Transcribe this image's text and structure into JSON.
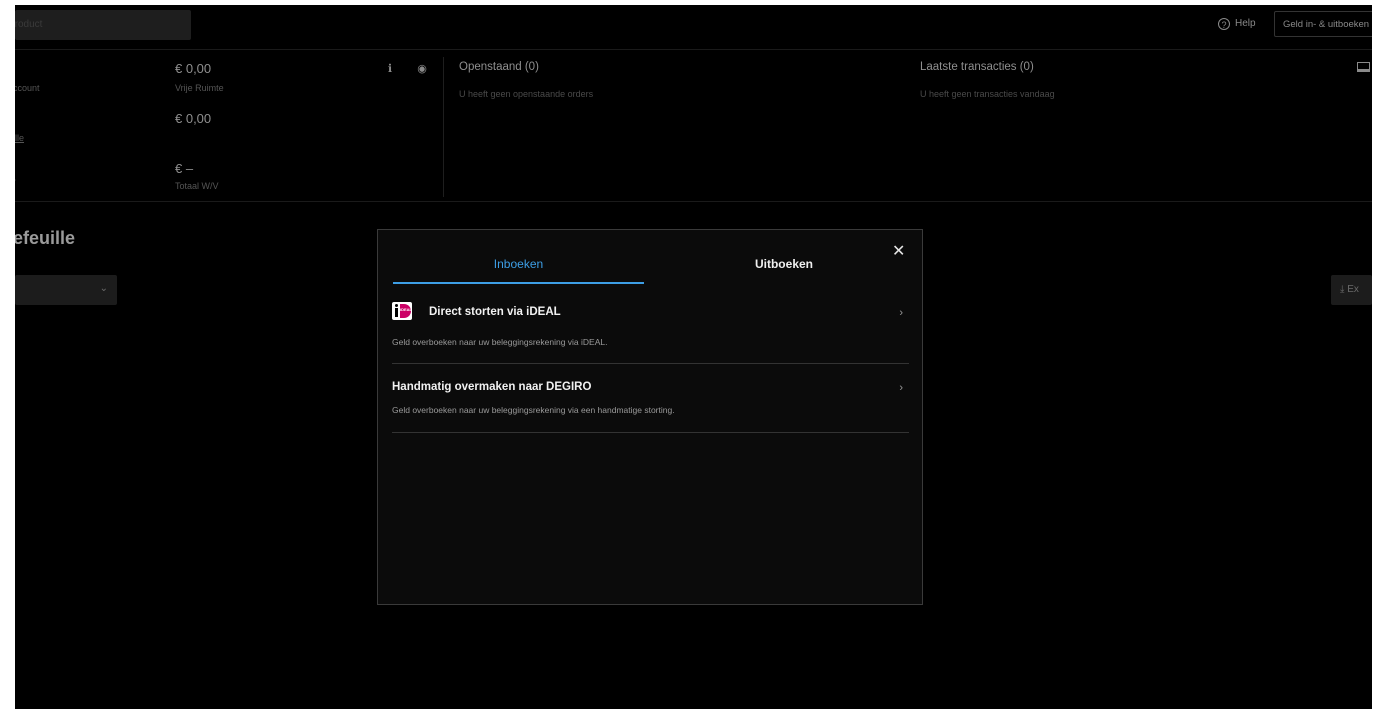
{
  "header": {
    "search_placeholder": "Product",
    "help_label": "Help",
    "deposit_button": "Geld in- & uitboeken"
  },
  "account": {
    "labels": [
      "ccount",
      "ille",
      "/"
    ],
    "free_space_amount": "€ 0,00",
    "free_space_label": "Vrije Ruimte",
    "second_amount": "€ 0,00",
    "total_amount": "€ –",
    "total_label": "Totaal W/V"
  },
  "open_orders": {
    "title": "Openstaand (0)",
    "empty_text": "U heeft geen openstaande orders"
  },
  "transactions": {
    "title": "Laatste transacties (0)",
    "empty_text": "U heeft geen transacties vandaag"
  },
  "portfolio": {
    "title": "efeuille",
    "export_label": "Ex"
  },
  "modal": {
    "tabs": [
      {
        "label": "Inboeken",
        "active": true
      },
      {
        "label": "Uitboeken",
        "active": false
      }
    ],
    "close_symbol": "✕",
    "options": [
      {
        "title": "Direct storten via iDEAL",
        "description": "Geld overboeken naar uw beleggingsrekening via iDEAL.",
        "icon": "ideal-logo"
      },
      {
        "title": "Handmatig overmaken naar DEGIRO",
        "description": "Geld overboeken naar uw beleggingsrekening via een handmatige storting.",
        "icon": null
      }
    ]
  },
  "colors": {
    "background": "#000000",
    "accent": "#3d9ee5",
    "ideal_pink": "#cc0066"
  }
}
